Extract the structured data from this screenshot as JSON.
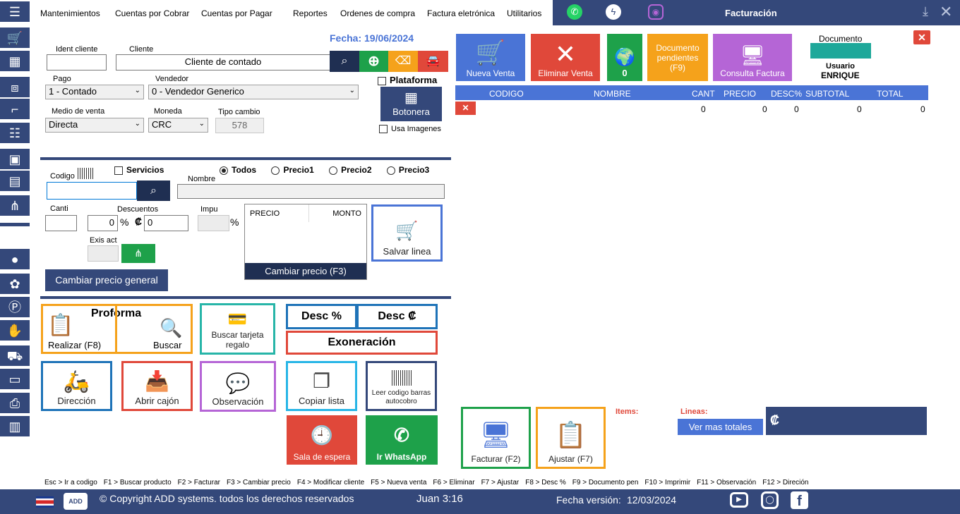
{
  "menu": [
    "Mantenimientos",
    "Cuentas por Cobrar",
    "Cuentas por Pagar",
    "Reportes",
    "Ordenes de compra",
    "Factura eletrónica",
    "Utilitarios"
  ],
  "window_title": "Facturación",
  "fecha_label": "Fecha: 19/06/2024",
  "cliente": {
    "ident_label": "Ident cliente",
    "ident_value": "",
    "cliente_label": "Cliente",
    "cliente_value": "Cliente de contado"
  },
  "pago": {
    "label": "Pago",
    "value": "1 - Contado"
  },
  "vendedor": {
    "label": "Vendedor",
    "value": "0 - Vendedor Generico"
  },
  "plataforma_label": "Plataforma",
  "botonera_label": "Botonera",
  "usa_imagenes_label": "Usa Imagenes",
  "medio": {
    "label": "Medio de venta",
    "value": "Directa"
  },
  "moneda": {
    "label": "Moneda",
    "value": "CRC"
  },
  "tipo_cambio": {
    "label": "Tipo cambio",
    "value": "578"
  },
  "servicios_label": "Servicios",
  "price_options": [
    "Todos",
    "Precio1",
    "Precio2",
    "Precio3"
  ],
  "codigo_label": "Codigo",
  "nombre_label": "Nombre",
  "canti_label": "Canti",
  "descuentos": {
    "label": "Descuentos",
    "pct": "0",
    "pct_sign": "%",
    "colon_sign": "₡",
    "amount": "0"
  },
  "impu": {
    "label": "Impu",
    "sign": "%"
  },
  "exis_act_label": "Exis act",
  "price_table": {
    "col_precio": "PRECIO",
    "col_monto": "MONTO",
    "button": "Cambiar precio (F3)"
  },
  "salvar_linea": "Salvar linea",
  "cambiar_precio_general": "Cambiar precio general",
  "proforma": {
    "title": "Proforma",
    "realizar": "Realizar (F8)",
    "buscar": "Buscar"
  },
  "buscar_tarjeta": "Buscar tarjeta regalo",
  "desc_pct": "Desc %",
  "desc_colon": "Desc ₡",
  "exoneracion": "Exoneración",
  "direccion": "Dirección",
  "abrir_cajon": "Abrir cajón",
  "observacion": "Observación",
  "copiar_lista": "Copiar lista",
  "leer_codigo": "Leer codigo barras autocobro",
  "sala_espera": "Sala de espera",
  "ir_whatsapp": "Ir WhatsApp",
  "tiles": {
    "nueva_venta": "Nueva Venta",
    "eliminar_venta": "Eliminar Venta",
    "map_count": "0",
    "doc_pendientes": "Documento pendientes (F9)",
    "consulta_factura": "Consulta Factura"
  },
  "documento": {
    "label": "Documento",
    "usuario_label": "Usuario",
    "usuario": "ENRIQUE"
  },
  "table": {
    "headers": [
      "CODIGO",
      "NOMBRE",
      "CANT",
      "PRECIO",
      "DESC%",
      "SUBTOTAL",
      "TOTAL"
    ],
    "row": {
      "cant": "0",
      "precio": "0",
      "desc": "0",
      "subtotal": "0",
      "total": "0"
    }
  },
  "items_label": "Items:",
  "lineas_label": "Lineas:",
  "ver_mas_totales": "Ver mas totales",
  "total_symbol": "₡",
  "facturar": "Facturar (F2)",
  "ajustar": "Ajustar (F7)",
  "shortcuts": [
    "Esc > Ir a codigo",
    "F1 > Buscar producto",
    "F2 > Facturar",
    "F3 > Cambiar precio",
    "F4 > Modificar cliente",
    "F5 > Nueva venta",
    "F6 > Eliminar",
    "F7 > Ajustar",
    "F8 > Desc %",
    "F9 > Documento pen",
    "F10 > Imprimir",
    "F11 > Observación",
    "F12 > Direción"
  ],
  "footer": {
    "copyright": "© Copyright ADD systems. todos los derechos reservados",
    "user_time": "Juan 3:16",
    "version_label": "Fecha versión:",
    "version_date": "12/03/2024"
  },
  "colors": {
    "navy": "#34487a",
    "green": "#1ea14a",
    "orange": "#f5a21b",
    "red": "#e0483a",
    "blue": "#4a74d6",
    "purple": "#b565d6"
  }
}
